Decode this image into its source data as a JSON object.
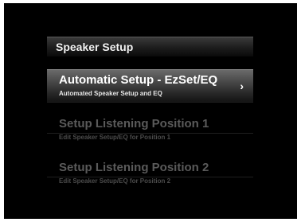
{
  "panel": {
    "title": "Speaker Setup"
  },
  "menu": {
    "items": [
      {
        "title": "Automatic Setup - EzSet/EQ",
        "subtitle": "Automated Speaker Setup and EQ",
        "selected": true,
        "icon": "chevron-right-icon",
        "chevron": "›"
      },
      {
        "title": "Setup Listening Position 1",
        "subtitle": "Edit Speaker Setup/EQ for Position 1",
        "selected": false
      },
      {
        "title": "Setup Listening Position 2",
        "subtitle": "Edit Speaker Setup/EQ for Position 2",
        "selected": false
      }
    ]
  },
  "colors": {
    "background": "#000000",
    "selected_text": "#ffffff",
    "dimmed_text": "#5a5a5a"
  }
}
